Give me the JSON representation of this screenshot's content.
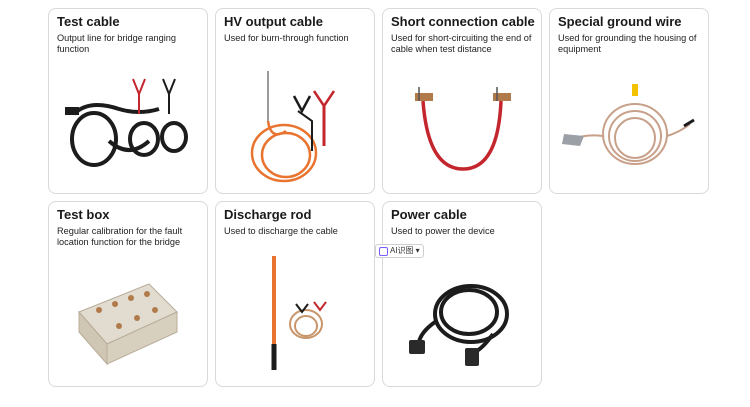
{
  "cards": [
    {
      "title": "Test cable",
      "description": "Output line for bridge ranging function",
      "image_icon": "test-cable-image"
    },
    {
      "title": "HV output cable",
      "description": "Used for burn-through function",
      "image_icon": "hv-output-cable-image"
    },
    {
      "title": "Short connection cable",
      "description": "Used for short-circuiting the end of cable when test distance",
      "image_icon": "short-connection-cable-image"
    },
    {
      "title": "Special ground wire",
      "description": "Used for grounding the housing of equipment",
      "image_icon": "ground-wire-image"
    },
    {
      "title": "Test box",
      "description": "Regular calibration for the fault location function for the bridge",
      "image_icon": "test-box-image"
    },
    {
      "title": "Discharge rod",
      "description": "Used to discharge the cable",
      "image_icon": "discharge-rod-image"
    },
    {
      "title": "Power cable",
      "description": "Used to power the device",
      "image_icon": "power-cable-image"
    }
  ],
  "ai_badge": {
    "label": "AI识图",
    "chevron": "▾"
  },
  "colors": {
    "border": "#d9d9d9",
    "cable_black": "#1c1c1c",
    "cable_red": "#c4262e",
    "cable_orange": "#e8742f",
    "copper": "#c8956a"
  }
}
